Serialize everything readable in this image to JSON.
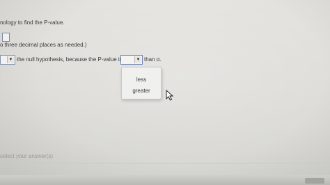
{
  "question": {
    "instruction": "nology to find the P-value.",
    "round_note": "o three decimal places as needed.)",
    "conclusion_text": "the null hypothesis, because the P-value is",
    "than_text": "than α.",
    "footer": "select your answer(s)"
  },
  "dropdown": {
    "options": [
      "less",
      "greater"
    ],
    "arrow_glyph": "▼"
  }
}
